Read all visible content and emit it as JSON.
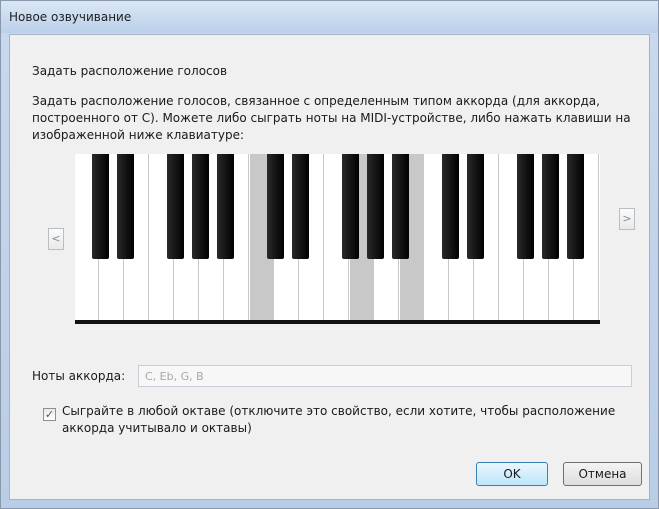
{
  "window": {
    "title": "Новое озвучивание"
  },
  "group": {
    "label": "Задать расположение голосов"
  },
  "description": {
    "line1": "Задать расположение голосов, связанное с определенным типом аккорда (для аккорда,",
    "line2": "построенного от C). Можете либо сыграть ноты на MIDI-устройстве, либо нажать клавиши на",
    "line3": "изображенной ниже клавиатуре:"
  },
  "keyboard": {
    "scroll_left_label": "<",
    "scroll_right_label": ">",
    "white_key_count": 21,
    "black_after_white": [
      0,
      1,
      3,
      4,
      5,
      7,
      8,
      10,
      11,
      12,
      14,
      15,
      17,
      18,
      19
    ],
    "highlighted_white": [
      7,
      11,
      13
    ]
  },
  "notes": {
    "label": "Ноты аккорда:",
    "value": "C, Eb, G, B"
  },
  "any_octave": {
    "checked": true,
    "check_mark": "✓",
    "label_line1": "Сыграйте в любой октаве (отключите это свойство, если хотите, чтобы расположение",
    "label_line2": "аккорда учитывало и октавы)"
  },
  "buttons": {
    "ok": "OK",
    "cancel": "Отмена"
  }
}
